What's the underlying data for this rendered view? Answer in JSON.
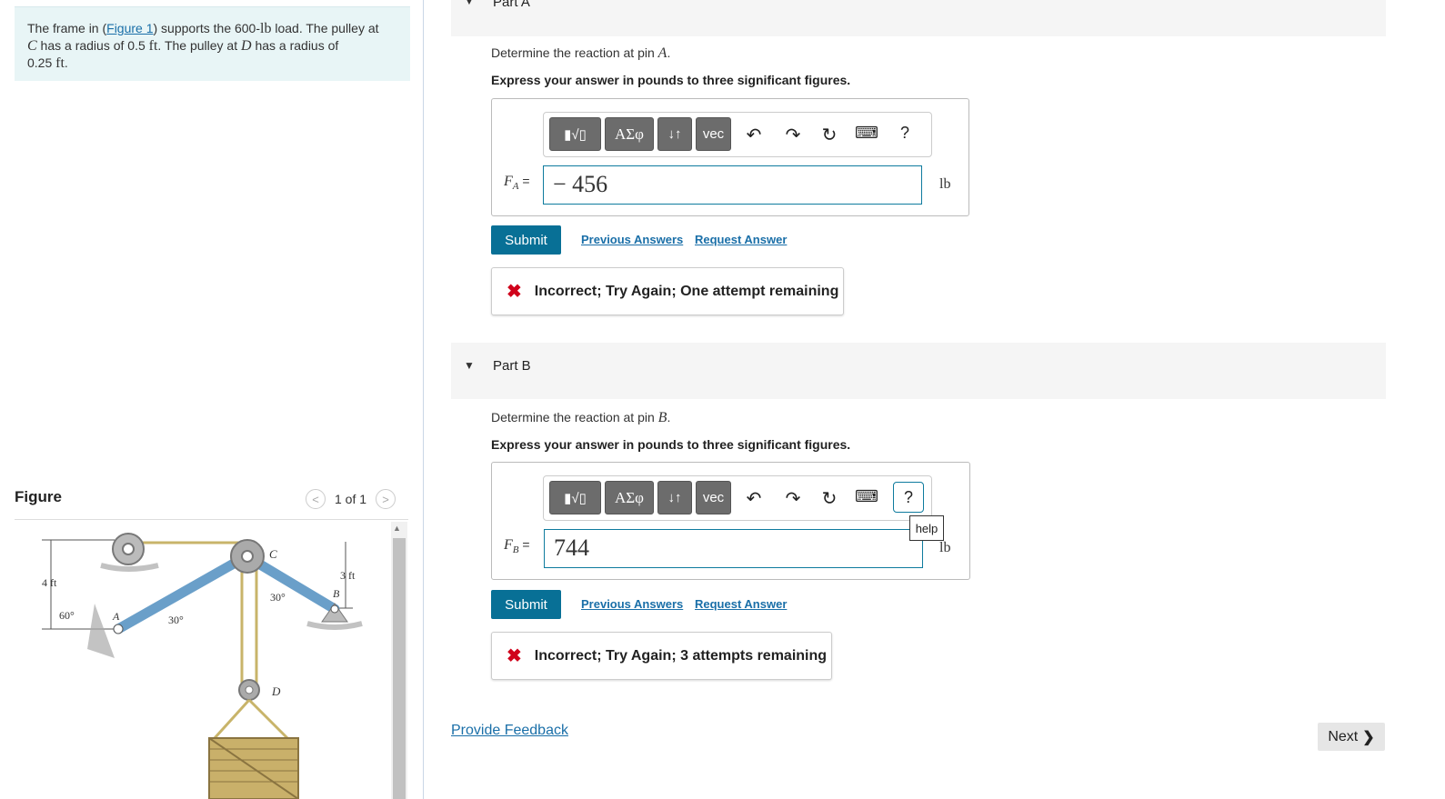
{
  "problem": {
    "p1": "The frame in (",
    "fig_link": "Figure 1",
    "p2": ") supports the 600-",
    "lb": "lb",
    "p3": " load. The pulley at",
    "C": "C",
    "p4": " has a radius of 0.5 ",
    "ft1": "ft",
    "p5": ". The pulley at ",
    "D": "D",
    "p6": " has a radius of",
    "p7": "0.25 ",
    "ft2": "ft",
    "p8": "."
  },
  "figure": {
    "title": "Figure",
    "pager": "1 of 1",
    "labels": {
      "dim4": "4 ft",
      "dim3": "3 ft",
      "a60": "60°",
      "a30a": "30°",
      "a30b": "30°",
      "A": "A",
      "B": "B",
      "C": "C",
      "D": "D"
    }
  },
  "partA": {
    "header": "Part A",
    "prompt_pre": "Determine the reaction at pin ",
    "prompt_var": "A",
    "prompt_post": ".",
    "instruction": "Express your answer in pounds to three significant figures.",
    "var_label": "F",
    "var_sub": "A",
    "eq": " =",
    "value": "− 456",
    "unit": "lb",
    "submit": "Submit",
    "prev": "Previous Answers",
    "request": "Request Answer",
    "feedback": "Incorrect; Try Again; One attempt remaining"
  },
  "partB": {
    "header": "Part B",
    "prompt_pre": "Determine the reaction at pin ",
    "prompt_var": "B",
    "prompt_post": ".",
    "instruction": "Express your answer in pounds to three significant figures.",
    "var_label": "F",
    "var_sub": "B",
    "eq": " =",
    "value": "744",
    "unit": "lb",
    "submit": "Submit",
    "prev": "Previous Answers",
    "request": "Request Answer",
    "feedback": "Incorrect; Try Again; 3 attempts remaining",
    "help_tip": "help"
  },
  "toolbar": {
    "templates": "▮√▯",
    "greek": "ΑΣφ",
    "arrows": "↓↑",
    "vec": "vec",
    "undo": "↶",
    "redo": "↷",
    "reset": "↻",
    "keyboard": "⌨",
    "help": "?"
  },
  "footer": {
    "feedback": "Provide Feedback",
    "next": "Next"
  },
  "icons": {
    "error": "x-icon",
    "nav_prev": "chevron-left-icon",
    "nav_next": "chevron-right-icon"
  },
  "colors": {
    "accent": "#087096",
    "error": "#d0021b",
    "link": "#1a6fa8"
  }
}
